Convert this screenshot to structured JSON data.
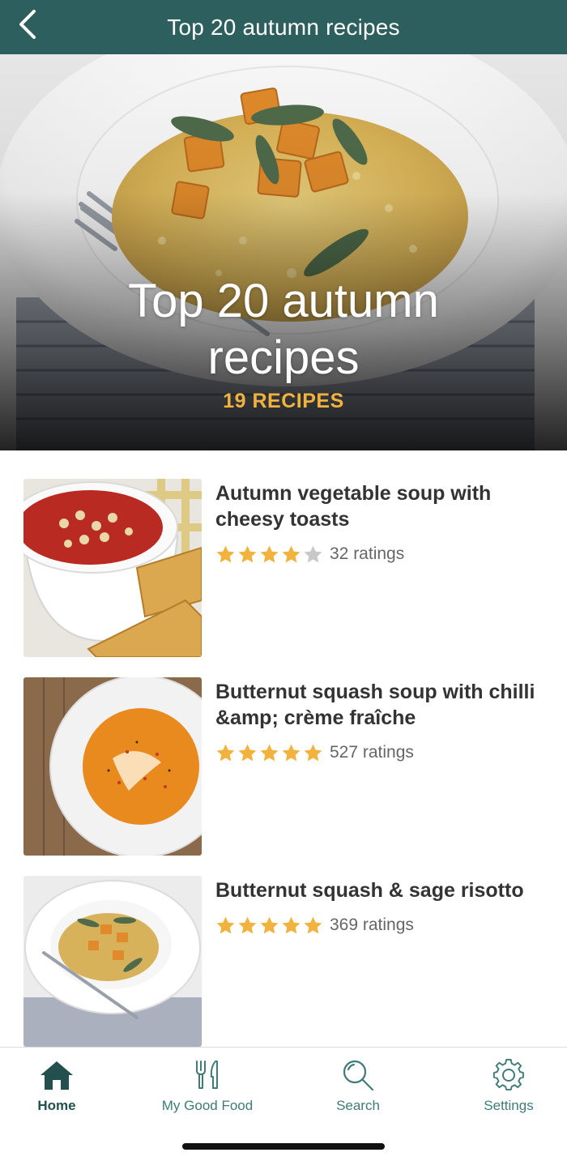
{
  "header": {
    "title": "Top 20 autumn recipes",
    "back_icon": "chevron-left-icon"
  },
  "hero": {
    "title": "Top 20 autumn recipes",
    "count": "19 RECIPES"
  },
  "recipes": [
    {
      "title": "Autumn vegetable soup with cheesy toasts",
      "rating": 4,
      "max_rating": 5,
      "ratings_label": "32 ratings"
    },
    {
      "title": "Butternut squash soup with chilli &amp; crème fraîche",
      "rating": 5,
      "max_rating": 5,
      "ratings_label": "527 ratings"
    },
    {
      "title": "Butternut squash & sage risotto",
      "rating": 5,
      "max_rating": 5,
      "ratings_label": "369 ratings"
    }
  ],
  "tabbar": {
    "tabs": [
      {
        "label": "Home",
        "icon": "home-icon",
        "active": true
      },
      {
        "label": "My Good Food",
        "icon": "cutlery-icon",
        "active": false
      },
      {
        "label": "Search",
        "icon": "search-icon",
        "active": false
      },
      {
        "label": "Settings",
        "icon": "gear-icon",
        "active": false
      }
    ]
  },
  "colors": {
    "header_bg": "#2c5f5d",
    "accent_gold": "#f2b23e",
    "star_filled": "#f2b23e",
    "star_empty": "#c8c8c8",
    "tab_active": "#23504e",
    "tab_inactive": "#3f7b78"
  }
}
